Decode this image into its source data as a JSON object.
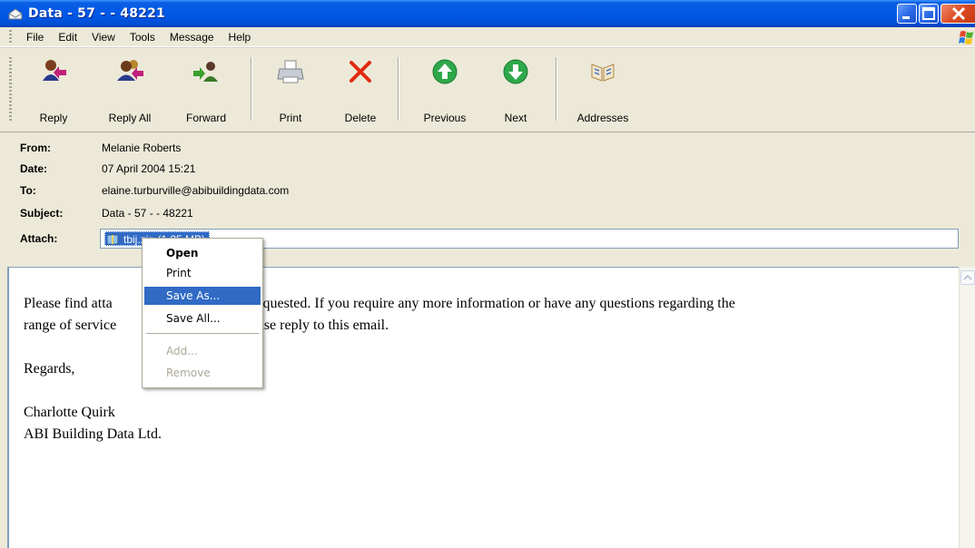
{
  "window": {
    "title": "Data - 57 -  - 48221"
  },
  "menu": {
    "items": [
      "File",
      "Edit",
      "View",
      "Tools",
      "Message",
      "Help"
    ]
  },
  "toolbar": {
    "reply": "Reply",
    "reply_all": "Reply All",
    "forward": "Forward",
    "print": "Print",
    "delete": "Delete",
    "previous": "Previous",
    "next": "Next",
    "addresses": "Addresses"
  },
  "header": {
    "from_label": "From:",
    "from_value": "Melanie Roberts",
    "date_label": "Date:",
    "date_value": "07 April 2004 15:21",
    "to_label": "To:",
    "to_value": "elaine.turburville@abibuildingdata.com",
    "subject_label": "Subject:",
    "subject_value": "Data - 57 -  - 48221",
    "attach_label": "Attach:",
    "attachment": "tbij.zip (1.25 MB)"
  },
  "context_menu": {
    "open": "Open",
    "print": "Print",
    "save_as": "Save As...",
    "save_all": "Save All...",
    "add": "Add...",
    "remove": "Remove"
  },
  "body": {
    "line1_a": "Please find atta",
    "line1_b": "as requested. If you require any more information or have any questions regarding the",
    "line2_a": "range of service",
    "line2_b": "please reply to this email.",
    "regards": "Regards,",
    "sig_name": "Charlotte Quirk",
    "sig_company": "ABI Building Data Ltd."
  },
  "colors": {
    "titlebar": "#0058E6",
    "selection": "#316AC5",
    "chrome": "#ECE9D8"
  }
}
